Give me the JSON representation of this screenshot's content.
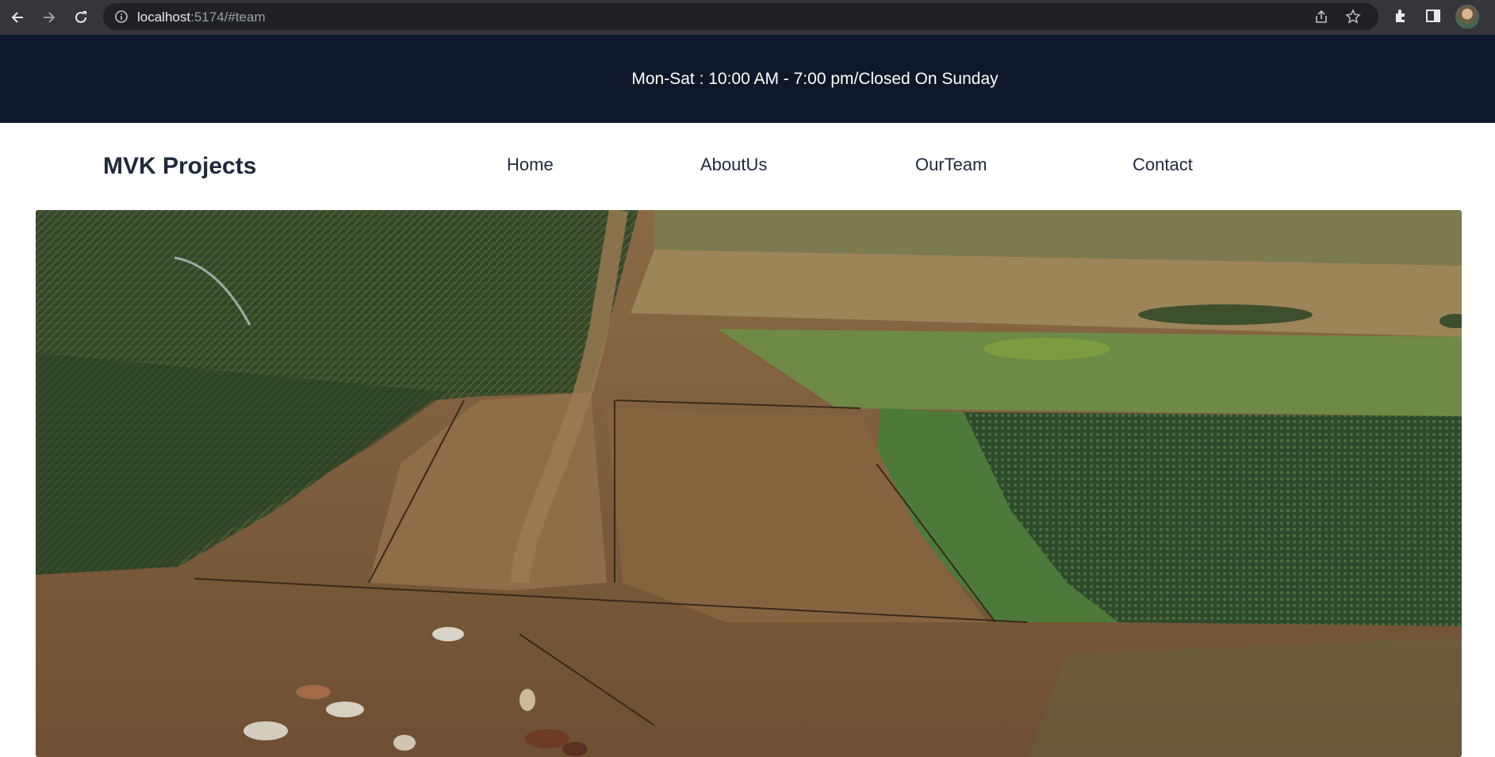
{
  "browser": {
    "url_host": "localhost",
    "url_rest": ":5174/#team",
    "icons": [
      "back-arrow-icon",
      "forward-arrow-icon",
      "reload-icon",
      "info-icon",
      "share-icon",
      "star-icon",
      "extensions-icon",
      "side-panel-icon"
    ]
  },
  "topbar": {
    "hours": "Mon-Sat : 10:00 AM - 7:00 pm/Closed On Sunday"
  },
  "navbar": {
    "brand": "MVK Projects",
    "links": [
      "Home",
      "AboutUs",
      "OurTeam",
      "Contact"
    ]
  },
  "colors": {
    "topbar_bg": "#0f172a",
    "text_dark": "#1e293b",
    "chrome_bg": "#35363a"
  }
}
